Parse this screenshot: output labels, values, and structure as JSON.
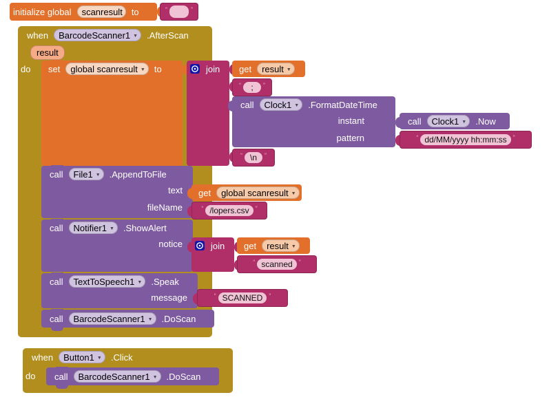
{
  "app": "MIT App Inventor Blocks Editor",
  "colors": {
    "background": "#ffffff",
    "event_block": "#b18e1e",
    "variable_block": "#e2702a",
    "text_block": "#b02f69",
    "method_call_block": "#7e5ba0",
    "mutator_icon": "#1314a8"
  },
  "blocks": {
    "init_global": {
      "kw_initialize": "initialize global",
      "name": "scanresult",
      "kw_to": "to",
      "value_text": ""
    },
    "event_afterscan": {
      "kw_when": "when",
      "component": "BarcodeScanner1",
      "event": ".AfterScan",
      "param": "result",
      "kw_do": "do",
      "statements": {
        "set_scanresult": {
          "kw_set": "set",
          "variable": "global scanresult",
          "kw_to": "to",
          "join": {
            "kw_join": "join",
            "arg1": {
              "kw_get": "get",
              "variable": "result"
            },
            "arg2_text": ";",
            "arg3_call": {
              "kw_call": "call",
              "component": "Clock1",
              "method": ".FormatDateTime",
              "args": [
                {
                  "label": "instant",
                  "value": {
                    "kw_call": "call",
                    "component": "Clock1",
                    "method": ".Now"
                  }
                },
                {
                  "label": "pattern",
                  "text": "dd/MM/yyyy hh:mm:ss"
                }
              ]
            },
            "arg4_text": "\\n"
          }
        },
        "append_to_file": {
          "kw_call": "call",
          "component": "File1",
          "method": ".AppendToFile",
          "args": [
            {
              "label": "text",
              "value": {
                "kw_get": "get",
                "variable": "global scanresult"
              }
            },
            {
              "label": "fileName",
              "text": "/lopers.csv"
            }
          ]
        },
        "show_alert": {
          "kw_call": "call",
          "component": "Notifier1",
          "method": ".ShowAlert",
          "args": [
            {
              "label": "notice",
              "join": {
                "kw_join": "join",
                "arg1": {
                  "kw_get": "get",
                  "variable": "result"
                },
                "arg2_text": "scanned"
              }
            }
          ]
        },
        "speak": {
          "kw_call": "call",
          "component": "TextToSpeech1",
          "method": ".Speak",
          "args": [
            {
              "label": "message",
              "text": "SCANNED"
            }
          ]
        },
        "do_scan": {
          "kw_call": "call",
          "component": "BarcodeScanner1",
          "method": ".DoScan"
        }
      }
    },
    "event_button_click": {
      "kw_when": "when",
      "component": "Button1",
      "event": ".Click",
      "kw_do": "do",
      "statement": {
        "kw_call": "call",
        "component": "BarcodeScanner1",
        "method": ".DoScan"
      }
    }
  }
}
